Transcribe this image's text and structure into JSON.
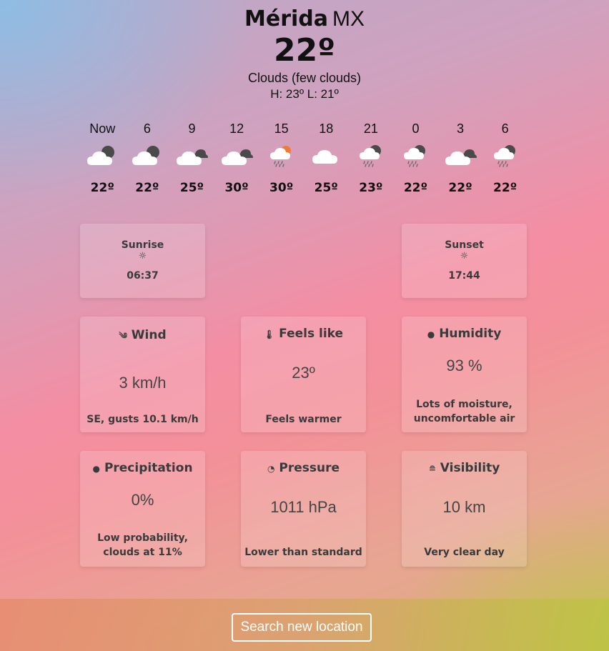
{
  "location": {
    "city": "Mérida",
    "country": "MX"
  },
  "current": {
    "temp": "22º",
    "condition": "Clouds (few clouds)",
    "high_low": "H: 23º L: 21º"
  },
  "hourly": [
    {
      "time": "Now",
      "icon": "cloud-moon-icon",
      "temp": "22º"
    },
    {
      "time": "6",
      "icon": "cloud-moon-icon",
      "temp": "22º"
    },
    {
      "time": "9",
      "icon": "broken-clouds-icon",
      "temp": "25º"
    },
    {
      "time": "12",
      "icon": "broken-clouds-icon",
      "temp": "30º"
    },
    {
      "time": "15",
      "icon": "sun-rain-icon",
      "temp": "30º"
    },
    {
      "time": "18",
      "icon": "cloud-icon",
      "temp": "25º"
    },
    {
      "time": "21",
      "icon": "moon-rain-icon",
      "temp": "23º"
    },
    {
      "time": "0",
      "icon": "moon-rain-icon",
      "temp": "22º"
    },
    {
      "time": "3",
      "icon": "broken-clouds-icon",
      "temp": "22º"
    },
    {
      "time": "6",
      "icon": "moon-rain-icon",
      "temp": "22º"
    }
  ],
  "sunrise": {
    "label": "Sunrise",
    "icon": "sun-icon",
    "time": "06:37"
  },
  "sunset": {
    "label": "Sunset",
    "icon": "sun-icon",
    "time": "17:44"
  },
  "stats": {
    "wind": {
      "icon": "wind-icon",
      "label": "Wind",
      "value": "3 km/h",
      "sub": "SE, gusts 10.1 km/h"
    },
    "feels_like": {
      "icon": "thermometer-icon",
      "label": "Feels like",
      "value": "23º",
      "sub": "Feels warmer"
    },
    "humidity": {
      "icon": "humidity-drop-icon",
      "label": "Humidity",
      "value": "93 %",
      "sub": "Lots of moisture, uncomfortable air"
    },
    "precipitation": {
      "icon": "raindrop-icon",
      "label": "Precipitation",
      "value": "0%",
      "sub": "Low probability, clouds at 11%"
    },
    "pressure": {
      "icon": "gauge-icon",
      "label": "Pressure",
      "value": "1011 hPa",
      "sub": "Lower than standard"
    },
    "visibility": {
      "icon": "fog-icon",
      "label": "Visibility",
      "value": "10 km",
      "sub": "Very clear day"
    }
  },
  "search_button": "Search new location",
  "colors": {
    "cloud": "#ffffff",
    "dark_cloud": "#4a4a4a",
    "sun": "#f07a3e",
    "rain": "#6a6a6a",
    "card_text": "#3a3a3a"
  }
}
